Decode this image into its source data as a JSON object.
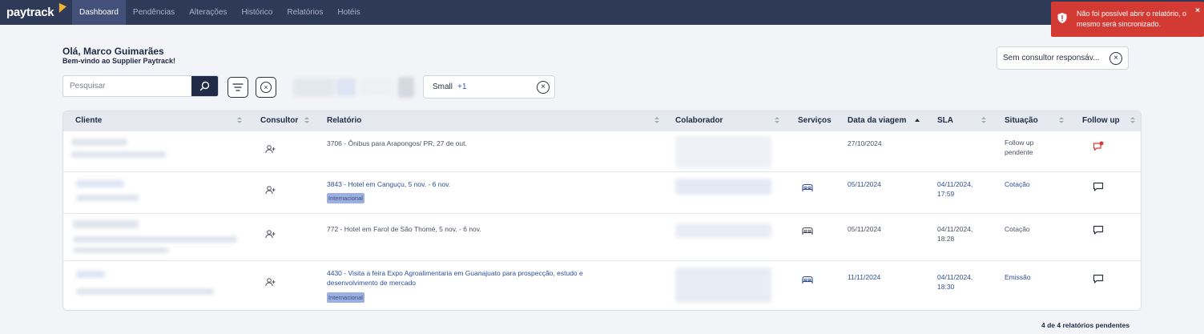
{
  "app": {
    "logo": "paytrack",
    "nav": [
      "Dashboard",
      "Pendências",
      "Alterações",
      "Histórico",
      "Relatórios",
      "Hotéis"
    ],
    "active_nav": "Dashboard"
  },
  "toast": {
    "message": "Não foi possível abrir o relatório, o mesmo será sincronizado.",
    "close": "×",
    "color": "#d33a34"
  },
  "greeting": {
    "name": "Olá, Marco Guimarães",
    "subtitle": "Bem-vindo ao Supplier Paytrack!"
  },
  "filters": {
    "consultant": "Sem consultor responsáv...",
    "search_placeholder": "Pesquisar",
    "size_label": "Small",
    "size_extra": "+1"
  },
  "table": {
    "columns": [
      "Cliente",
      "Consultor",
      "Relatório",
      "Colaborador",
      "Serviços",
      "Data da viagem",
      "SLA",
      "Situação",
      "Follow up"
    ],
    "rows": [
      {
        "relatorio": "3706 - Ônibus para Arapongos/ PR, 27 de out.",
        "relatorio_link": false,
        "badge": "",
        "service": "",
        "date": "27/10/2024",
        "sla_1": "",
        "sla_2": "",
        "situacao_1": "Follow up",
        "situacao_2": "pendente",
        "followup": "chat-alert-icon"
      },
      {
        "relatorio": "3843 - Hotel em Canguçu, 5 nov. - 6 nov.",
        "relatorio_link": true,
        "badge": "Internacional",
        "service": "bed-icon",
        "date": "05/11/2024",
        "sla_1": "04/11/2024,",
        "sla_2": "17:59",
        "situacao_1": "Cotação",
        "situacao_2": "",
        "followup": "chat-icon"
      },
      {
        "relatorio": "772 - Hotel em Farol de São Thomé, 5 nov. - 6 nov.",
        "relatorio_link": false,
        "badge": "",
        "service": "bed-icon",
        "date": "05/11/2024",
        "sla_1": "04/11/2024,",
        "sla_2": "18:28",
        "situacao_1": "Cotação",
        "situacao_2": "",
        "followup": "chat-icon"
      },
      {
        "relatorio": "4430 - Visita a feira Expo Agroalimentaria em Guanajuato para prospecção, estudo e",
        "relatorio_2": "desenvolvimento de mercado",
        "relatorio_link": true,
        "badge": "Internacional",
        "service": "bed-icon",
        "date": "11/11/2024",
        "sla_1": "04/11/2024,",
        "sla_2": "18:30",
        "situacao_1": "Emissão",
        "situacao_2": "",
        "followup": "chat-icon"
      }
    ]
  },
  "footer": {
    "count": "4 de 4 relatórios pendentes"
  }
}
